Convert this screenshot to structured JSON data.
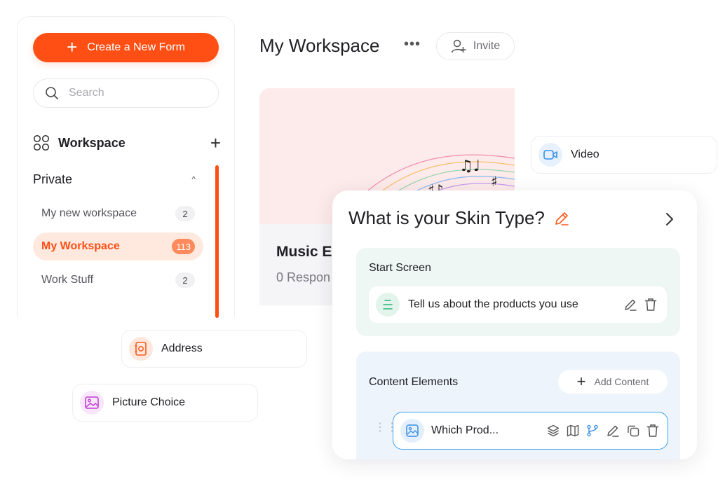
{
  "sidebar": {
    "create_button": "Create a New Form",
    "search_placeholder": "Search",
    "workspace_heading": "Workspace",
    "private_label": "Private",
    "items": [
      {
        "label": "My new workspace",
        "count": "2"
      },
      {
        "label": "My Workspace",
        "count": "113"
      },
      {
        "label": "Work Stuff",
        "count": "2"
      }
    ]
  },
  "header": {
    "title": "My Workspace",
    "more": "•••",
    "invite": "Invite"
  },
  "form_card": {
    "name": "Music E",
    "responses": "0 Respon"
  },
  "chips": {
    "video": "Video",
    "address": "Address",
    "picture_choice": "Picture Choice"
  },
  "skin_card": {
    "title": "What is your Skin Type?",
    "start_screen_label": "Start Screen",
    "start_item": "Tell us about the products you use",
    "content_label": "Content Elements",
    "add_content": "Add Content",
    "question_item": "Which Prod..."
  },
  "colors": {
    "accent": "#ff4f15",
    "active_bg": "#ffe9df",
    "selected_border": "#3aa0f0"
  }
}
